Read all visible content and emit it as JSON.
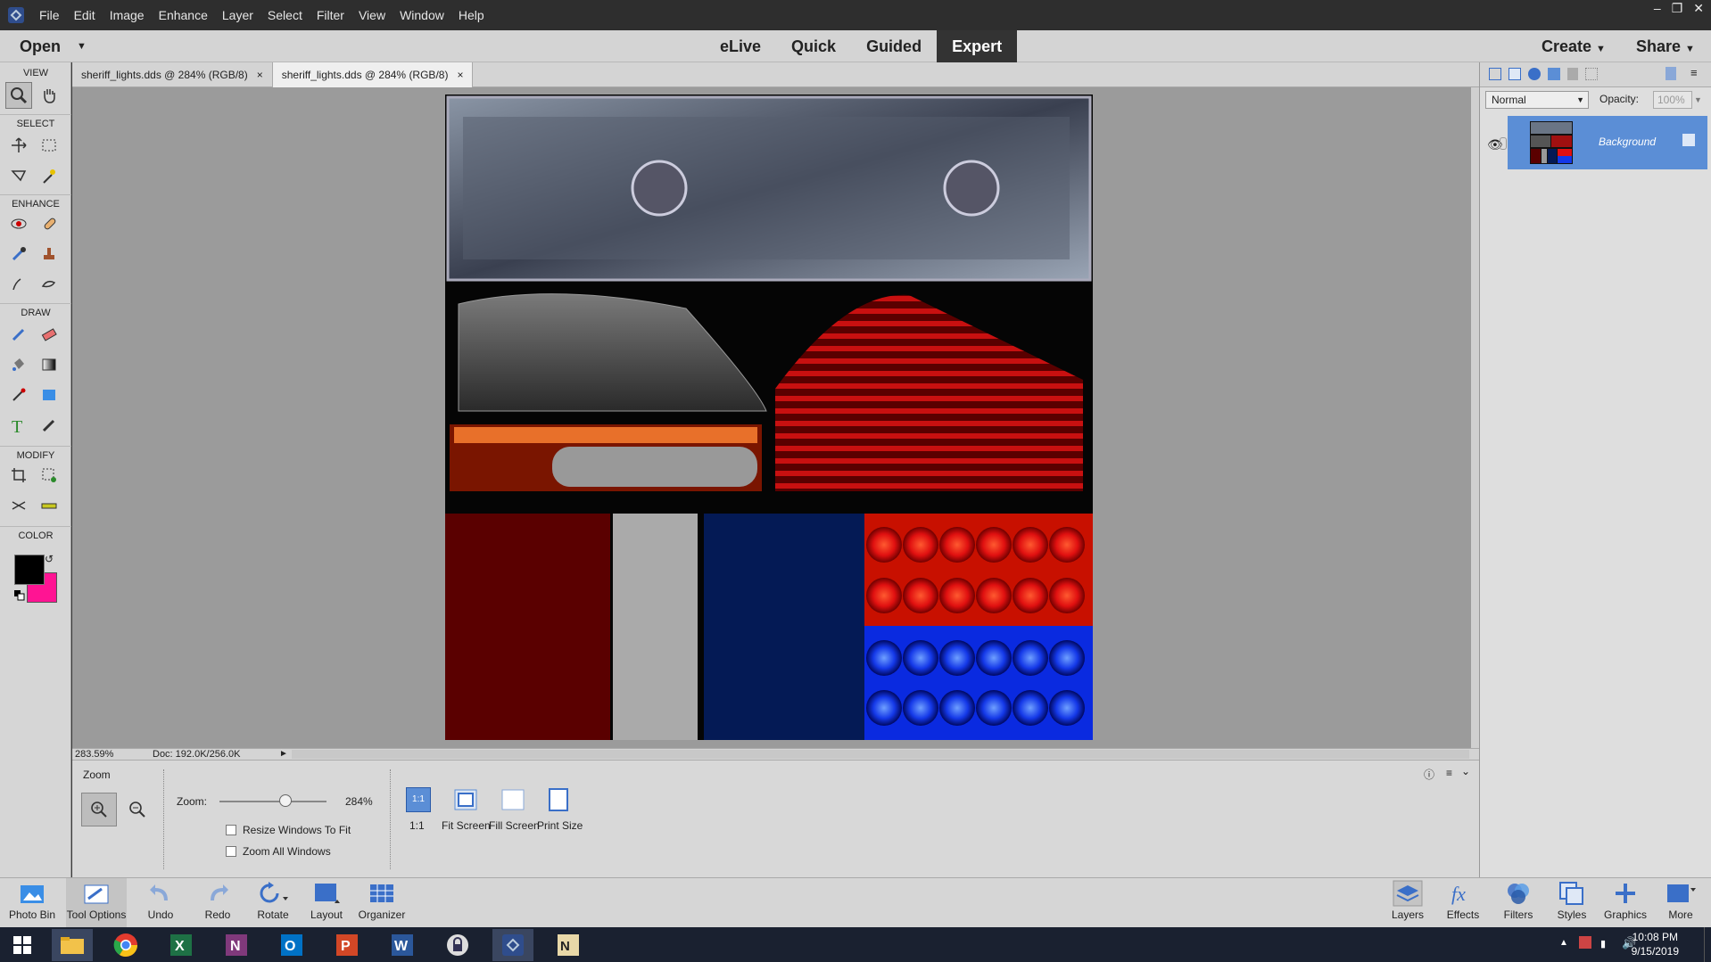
{
  "menubar": {
    "items": [
      "File",
      "Edit",
      "Image",
      "Enhance",
      "Layer",
      "Select",
      "Filter",
      "View",
      "Window",
      "Help"
    ]
  },
  "modebar": {
    "open": "Open",
    "modes": [
      "eLive",
      "Quick",
      "Guided",
      "Expert"
    ],
    "active_mode": "Expert",
    "create": "Create",
    "share": "Share"
  },
  "toolbox": {
    "sections": [
      "VIEW",
      "SELECT",
      "ENHANCE",
      "DRAW",
      "MODIFY",
      "COLOR"
    ],
    "foreground_color": "#000000",
    "background_color": "#ff1493"
  },
  "tabs": [
    {
      "label": "sheriff_lights.dds @ 284% (RGB/8)",
      "close": "×"
    },
    {
      "label": "sheriff_lights.dds @ 284% (RGB/8)",
      "close": "×"
    }
  ],
  "statusbar": {
    "zoom": "283.59%",
    "doc": "Doc: 192.0K/256.0K"
  },
  "tool_options": {
    "title": "Zoom",
    "zoom_label": "Zoom:",
    "zoom_value": "284%",
    "zoom_level": 0.62,
    "resize_windows": "Resize Windows To Fit",
    "zoom_all": "Zoom All Windows",
    "buttons": [
      "1:1",
      "Fit Screen",
      "Fill Screen",
      "Print Size"
    ],
    "one_to_one_icon_text": "1:1"
  },
  "layers_panel": {
    "blend_mode": "Normal",
    "opacity_label": "Opacity:",
    "opacity_value": "100%",
    "layer_name": "Background"
  },
  "bottombar": {
    "left": [
      "Photo Bin",
      "Tool Options",
      "Undo",
      "Redo",
      "Rotate",
      "Layout",
      "Organizer"
    ],
    "right": [
      "Layers",
      "Effects",
      "Filters",
      "Styles",
      "Graphics",
      "More"
    ]
  },
  "taskbar": {
    "time": "10:08 PM",
    "date": "9/15/2019"
  },
  "colors": {
    "accent": "#5b8ed6",
    "menubar": "#2e2e2e"
  }
}
